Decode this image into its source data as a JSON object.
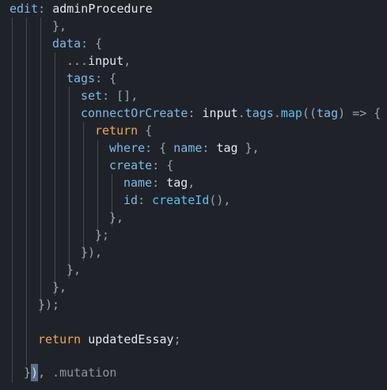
{
  "editor": {
    "lines": [
      {
        "segments": [
          {
            "t": "edit",
            "c": "p"
          },
          {
            "t": ": ",
            "c": "pn"
          },
          {
            "t": "adminProcedure",
            "c": "v"
          }
        ]
      },
      {
        "segments": [
          {
            "t": "},",
            "c": "pn"
          }
        ]
      },
      {
        "segments": [
          {
            "t": "data",
            "c": "p"
          },
          {
            "t": ": {",
            "c": "pn"
          }
        ]
      },
      {
        "segments": [
          {
            "t": "...",
            "c": "pn"
          },
          {
            "t": "input",
            "c": "v"
          },
          {
            "t": ",",
            "c": "pn"
          }
        ]
      },
      {
        "segments": [
          {
            "t": "tags",
            "c": "p"
          },
          {
            "t": ": {",
            "c": "pn"
          }
        ]
      },
      {
        "segments": [
          {
            "t": "set",
            "c": "p"
          },
          {
            "t": ": [],",
            "c": "pn"
          }
        ]
      },
      {
        "segments": [
          {
            "t": "connectOrCreate",
            "c": "p"
          },
          {
            "t": ": ",
            "c": "pn"
          },
          {
            "t": "input",
            "c": "v"
          },
          {
            "t": ".",
            "c": "pn"
          },
          {
            "t": "tags",
            "c": "p"
          },
          {
            "t": ".",
            "c": "pn"
          },
          {
            "t": "map",
            "c": "f"
          },
          {
            "t": "((",
            "c": "pn"
          },
          {
            "t": "tag",
            "c": "p"
          },
          {
            "t": ") => {",
            "c": "pn"
          }
        ]
      },
      {
        "segments": [
          {
            "t": "return",
            "c": "k"
          },
          {
            "t": " {",
            "c": "pn"
          }
        ]
      },
      {
        "segments": [
          {
            "t": "where",
            "c": "p"
          },
          {
            "t": ": { ",
            "c": "pn"
          },
          {
            "t": "name",
            "c": "p"
          },
          {
            "t": ": ",
            "c": "pn"
          },
          {
            "t": "tag",
            "c": "v"
          },
          {
            "t": " },",
            "c": "pn"
          }
        ]
      },
      {
        "segments": [
          {
            "t": "create",
            "c": "p"
          },
          {
            "t": ": {",
            "c": "pn"
          }
        ]
      },
      {
        "segments": [
          {
            "t": "name",
            "c": "p"
          },
          {
            "t": ": ",
            "c": "pn"
          },
          {
            "t": "tag",
            "c": "v"
          },
          {
            "t": ",",
            "c": "pn"
          }
        ]
      },
      {
        "segments": [
          {
            "t": "id",
            "c": "p"
          },
          {
            "t": ": ",
            "c": "pn"
          },
          {
            "t": "createId",
            "c": "f"
          },
          {
            "t": "(),",
            "c": "pn"
          }
        ]
      },
      {
        "segments": [
          {
            "t": "},",
            "c": "pn"
          }
        ]
      },
      {
        "segments": [
          {
            "t": "};",
            "c": "pn"
          }
        ]
      },
      {
        "segments": [
          {
            "t": "}),",
            "c": "pn"
          }
        ]
      },
      {
        "segments": [
          {
            "t": "},",
            "c": "pn"
          }
        ]
      },
      {
        "segments": [
          {
            "t": "},",
            "c": "pn"
          }
        ]
      },
      {
        "segments": [
          {
            "t": "});",
            "c": "pn"
          }
        ]
      },
      {
        "segments": []
      },
      {
        "segments": [
          {
            "t": "return",
            "c": "k"
          },
          {
            "t": " ",
            "c": "pn"
          },
          {
            "t": "updatedEssay",
            "c": "v"
          },
          {
            "t": ";",
            "c": "pn"
          }
        ]
      },
      {
        "segments": [
          {
            "t": "}",
            "c": "pn"
          },
          {
            "t": ")",
            "c": "cursor-block"
          },
          {
            "t": ", ",
            "c": "pn"
          },
          {
            "t": ".mutation",
            "c": "dim"
          }
        ]
      }
    ]
  }
}
